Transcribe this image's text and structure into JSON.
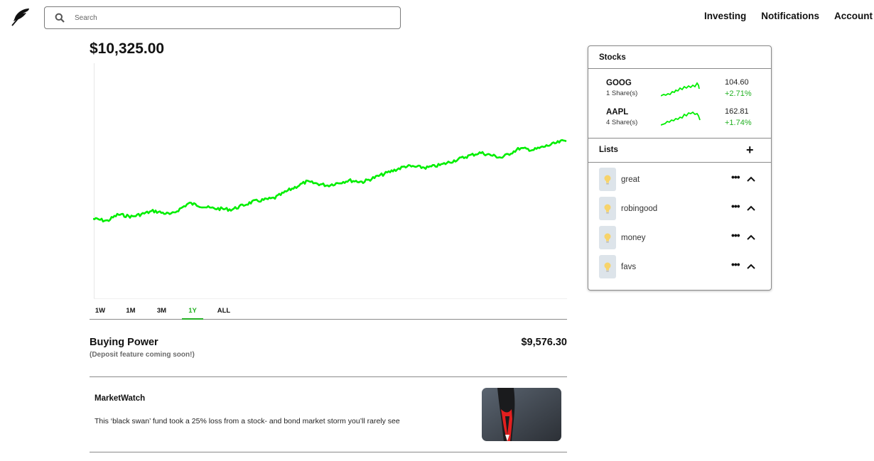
{
  "header": {
    "logo_icon": "feather-logo-icon",
    "search": {
      "placeholder": "Search",
      "icon": "search-icon"
    },
    "nav": [
      {
        "label": "Investing"
      },
      {
        "label": "Notifications"
      },
      {
        "label": "Account"
      }
    ]
  },
  "portfolio": {
    "value": "$10,325.00",
    "line_color": "#00ee00",
    "ranges": [
      "1W",
      "1M",
      "3M",
      "1Y",
      "ALL"
    ],
    "active_range": "1Y"
  },
  "buying_power": {
    "title": "Buying Power",
    "subtitle": "(Deposit feature coming soon!)",
    "value": "$9,576.30"
  },
  "news": {
    "source": "MarketWatch",
    "headline": "This ‘black swan’ fund took a 25% loss from a stock- and bond market storm you’ll rarely see",
    "image": "black-swan-image"
  },
  "sidebar": {
    "stocks_title": "Stocks",
    "stocks": [
      {
        "symbol": "GOOG",
        "shares": "1 Share(s)",
        "price": "104.60",
        "change": "+2.71%"
      },
      {
        "symbol": "AAPL",
        "shares": "4 Share(s)",
        "price": "162.81",
        "change": "+1.74%"
      }
    ],
    "lists_title": "Lists",
    "add_icon": "plus-icon",
    "lists": [
      {
        "name": "great",
        "icon": "lightbulb-icon"
      },
      {
        "name": "robingood",
        "icon": "lightbulb-icon"
      },
      {
        "name": "money",
        "icon": "lightbulb-icon"
      },
      {
        "name": "favs",
        "icon": "lightbulb-icon"
      }
    ]
  },
  "colors": {
    "accent_green": "#22b022",
    "chart_green": "#00ee00"
  }
}
